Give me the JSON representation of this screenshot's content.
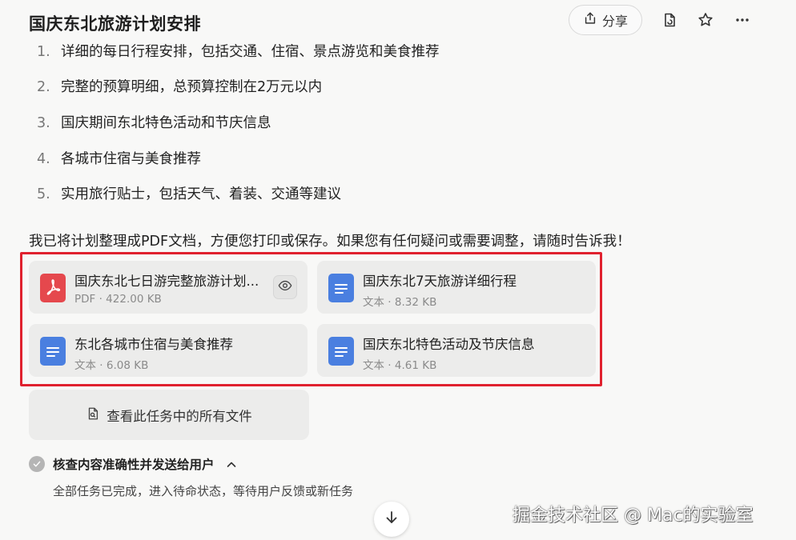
{
  "header": {
    "title": "国庆东北旅游计划安排",
    "share_label": "分享"
  },
  "list": [
    {
      "num": "1.",
      "text": "详细的每日行程安排，包括交通、住宿、景点游览和美食推荐"
    },
    {
      "num": "2.",
      "text": "完整的预算明细，总预算控制在2万元以内"
    },
    {
      "num": "3.",
      "text": "国庆期间东北特色活动和节庆信息"
    },
    {
      "num": "4.",
      "text": "各城市住宿与美食推荐"
    },
    {
      "num": "5.",
      "text": "实用旅行贴士，包括天气、着装、交通等建议"
    }
  ],
  "summary": "我已将计划整理成PDF文档，方便您打印或保存。如果您有任何疑问或需要调整，请随时告诉我！",
  "files": [
    {
      "name": "国庆东北七日游完整旅游计划...",
      "meta": "PDF · 422.00 KB",
      "icon": "pdf-file-icon"
    },
    {
      "name": "国庆东北7天旅游详细行程",
      "meta": "文本 · 8.32 KB",
      "icon": "doc-file-icon"
    },
    {
      "name": "东北各城市住宿与美食推荐",
      "meta": "文本 · 6.08 KB",
      "icon": "doc-file-icon"
    },
    {
      "name": "国庆东北特色活动及节庆信息",
      "meta": "文本 · 4.61 KB",
      "icon": "doc-file-icon"
    }
  ],
  "all_files_label": "查看此任务中的所有文件",
  "task": {
    "label": "核查内容准确性并发送给用户",
    "desc": "全部任务已完成，进入待命状态，等待用户反馈或新任务"
  },
  "watermark": "掘金技术社区 @ Mac的实验室",
  "colors": {
    "highlight": "#e0212e",
    "pdf_red": "#e5484d",
    "doc_blue": "#4a7fe0",
    "card_bg": "#ececeb"
  }
}
